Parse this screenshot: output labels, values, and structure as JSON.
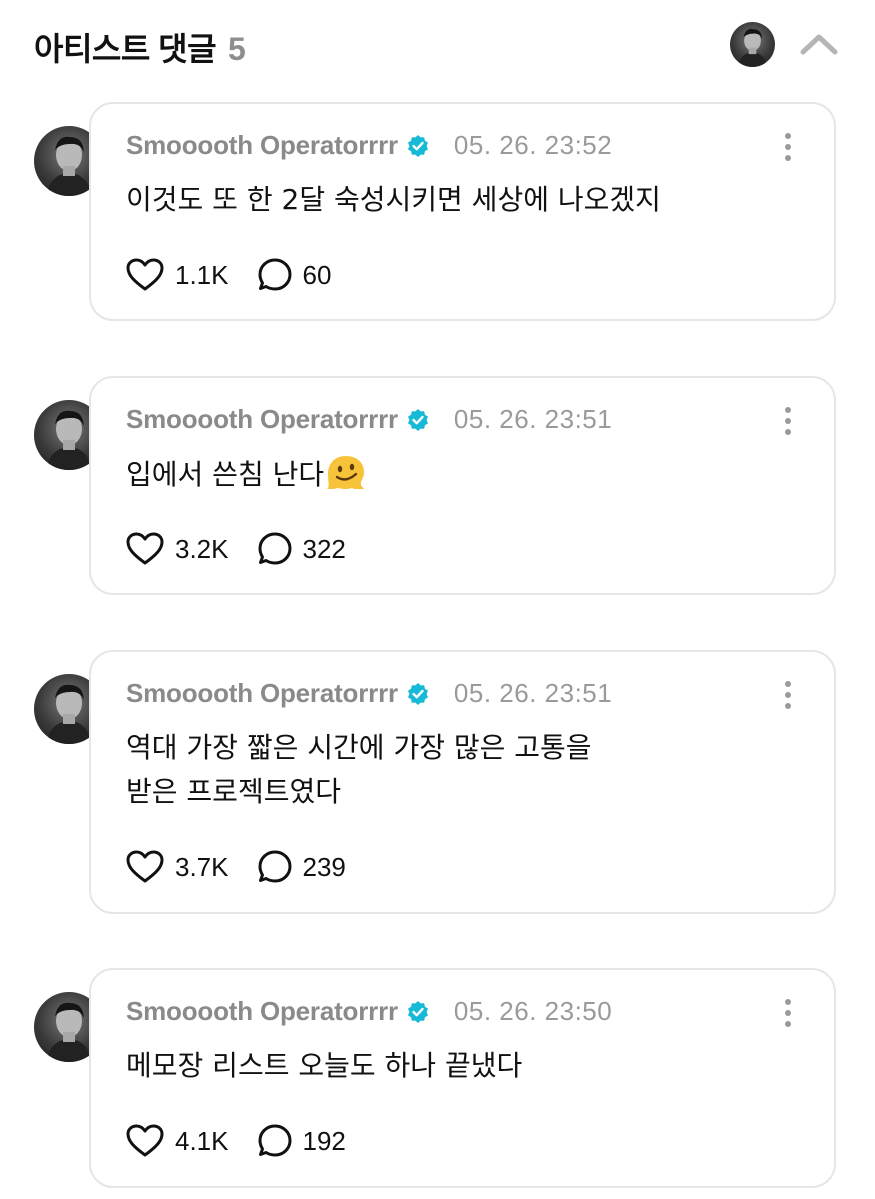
{
  "header": {
    "title": "아티스트 댓글",
    "count": "5"
  },
  "comments": [
    {
      "author": "Smooooth Operatorrrr",
      "timestamp": "05. 26. 23:52",
      "text": "이것도 또 한 2달 숙성시키면 세상에 나오겠지",
      "likes": "1.1K",
      "replies": "60"
    },
    {
      "author": "Smooooth Operatorrrr",
      "timestamp": "05. 26. 23:51",
      "text": "입에서 쓴침 난다",
      "emoji": "melting-face-emoji",
      "likes": "3.2K",
      "replies": "322"
    },
    {
      "author": "Smooooth Operatorrrr",
      "timestamp": "05. 26. 23:51",
      "text": "역대 가장 짧은 시간에 가장 많은 고통을\n받은 프로젝트였다",
      "likes": "3.7K",
      "replies": "239"
    },
    {
      "author": "Smooooth Operatorrrr",
      "timestamp": "05. 26. 23:50",
      "text": "메모장 리스트 오늘도 하나 끝냈다",
      "likes": "4.1K",
      "replies": "192"
    }
  ],
  "icons": {
    "verified": "verified-badge-icon",
    "like": "heart-icon",
    "reply": "speech-bubble-icon",
    "more": "more-vertical-icon",
    "collapse": "chevron-up-icon"
  },
  "colors": {
    "verified_badge": "#16b9d6",
    "author_text": "#8a8a8a",
    "card_border": "#e6e6e6"
  }
}
